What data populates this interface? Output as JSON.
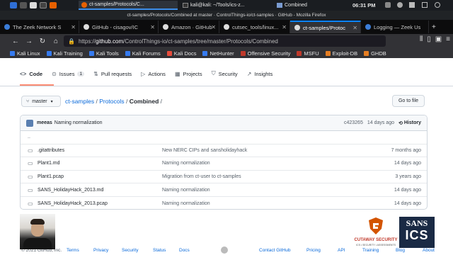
{
  "panel": {
    "tasks": [
      {
        "label": ""
      },
      {
        "label": "ct-samples/Protocols/C..."
      },
      {
        "label": "kali@kali: ~/Tools/ics-z..."
      },
      {
        "label": "Combined"
      }
    ],
    "clock": "06:31 PM"
  },
  "window_title": "ct-samples/Protocols/Combined at master · ControlThings-io/ct-samples · GitHub - Mozilla Firefox",
  "tabs": [
    {
      "label": "The Zeek Network S",
      "color": "#3b7dd8"
    },
    {
      "label": "GitHub - cisagov/IC",
      "color": "#ffffff"
    },
    {
      "label": "Amazon · GitHub",
      "color": "#ffffff"
    },
    {
      "label": "cutsec_tools/linux...",
      "color": "#ffffff"
    },
    {
      "label": "ct-samples/Protoc",
      "color": "#ffffff"
    },
    {
      "label": "Logging — Zeek Us",
      "color": "#3b7dd8"
    }
  ],
  "nav": {
    "url_prefix": "https://",
    "url_host": "github.com",
    "url_path": "/ControlThings-io/ct-samples/tree/master/Protocols/Combined"
  },
  "bookmarks": [
    {
      "label": "Kali Linux",
      "color": "#367bf0"
    },
    {
      "label": "Kali Training",
      "color": "#367bf0"
    },
    {
      "label": "Kali Tools",
      "color": "#367bf0"
    },
    {
      "label": "Kali Forums",
      "color": "#367bf0"
    },
    {
      "label": "Kali Docs",
      "color": "#e74c3c"
    },
    {
      "label": "NetHunter",
      "color": "#367bf0"
    },
    {
      "label": "Offensive Security",
      "color": "#c0392b"
    },
    {
      "label": "MSFU",
      "color": "#c0392b"
    },
    {
      "label": "Exploit-DB",
      "color": "#e67e22"
    },
    {
      "label": "GHDB",
      "color": "#e67e22"
    }
  ],
  "repo_nav": [
    {
      "label": "Code",
      "icon": "<>"
    },
    {
      "label": "Issues",
      "icon": "⊙",
      "count": "1"
    },
    {
      "label": "Pull requests",
      "icon": "⇅"
    },
    {
      "label": "Actions",
      "icon": "▷"
    },
    {
      "label": "Projects",
      "icon": "▦"
    },
    {
      "label": "Security",
      "icon": "⛉"
    },
    {
      "label": "Insights",
      "icon": "↗"
    }
  ],
  "branch": "master",
  "breadcrumb": {
    "repo": "ct-samples",
    "sep1": " / ",
    "folder": "Protocols",
    "sep2": " / ",
    "current": "Combined",
    "sep3": " /"
  },
  "goto_file": "Go to file",
  "commit": {
    "author": "meeas",
    "message": "Naming normalization",
    "hash": "c423265",
    "age": "14 days ago",
    "history": "History"
  },
  "files": [
    {
      "name": "..",
      "message": "",
      "age": ""
    },
    {
      "name": ".gitattributes",
      "message": "New NERC CIPs and sansholidayhack",
      "age": "7 months ago"
    },
    {
      "name": "Plant1.md",
      "message": "Naming normalization",
      "age": "14 days ago"
    },
    {
      "name": "Plant1.pcap",
      "message": "Migration from ct-user to ct-samples",
      "age": "3 years ago"
    },
    {
      "name": "SANS_HolidayHack_2013.md",
      "message": "Naming normalization",
      "age": "14 days ago"
    },
    {
      "name": "SANS_HolidayHack_2013.pcap",
      "message": "Naming normalization",
      "age": "14 days ago"
    }
  ],
  "footer": {
    "copyright": "© 2021 GitHub, Inc.",
    "links": [
      "Terms",
      "Privacy",
      "Security",
      "Status",
      "Docs",
      "Contact GitHub",
      "Pricing",
      "API",
      "Training",
      "Blog",
      "About"
    ]
  },
  "logos": {
    "cutaway": "CUTAWAY SECURITY",
    "cutaway_sub": "ICS • SECURITY • ASSESSMENTS",
    "sans_top": "SANS",
    "sans_bottom": "ICS"
  }
}
